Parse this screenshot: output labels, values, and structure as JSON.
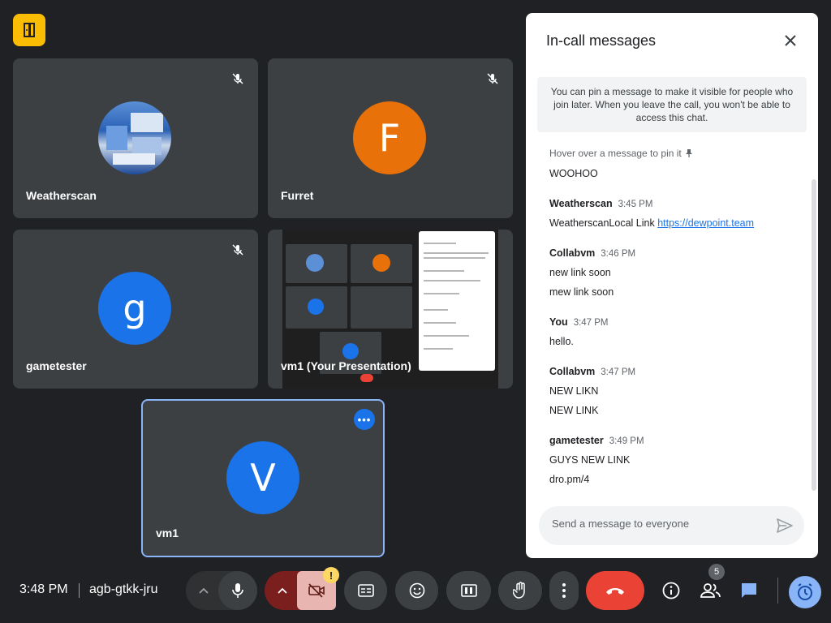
{
  "participants": [
    {
      "name": "Weatherscan",
      "type": "image"
    },
    {
      "name": "Furret",
      "initial": "F",
      "color": "#e8710a"
    },
    {
      "name": "gametester",
      "initial": "g",
      "color": "#1a73e8"
    },
    {
      "name": "vm1 (Your Presentation)",
      "type": "presentation"
    },
    {
      "name": "vm1",
      "initial": "V",
      "color": "#1a73e8"
    }
  ],
  "chat": {
    "title": "In-call messages",
    "pin_info": "You can pin a message to make it visible for people who join later. When you leave the call, you won't be able to access this chat.",
    "hover_hint": "Hover over a message to pin it",
    "first_message": "WOOHOO",
    "messages": [
      {
        "sender": "Weatherscan",
        "time": "3:45 PM",
        "lines": [
          "WeatherscanLocal Link",
          "https://dewpoint.team"
        ]
      },
      {
        "sender": "Collabvm",
        "time": "3:46 PM",
        "lines": [
          "new link soon",
          "mew link soon"
        ]
      },
      {
        "sender": "You",
        "time": "3:47 PM",
        "lines": [
          "hello."
        ]
      },
      {
        "sender": "Collabvm",
        "time": "3:47 PM",
        "lines": [
          "NEW LIKN",
          "NEW LINK"
        ]
      },
      {
        "sender": "gametester",
        "time": "3:49 PM",
        "lines": [
          "GUYS NEW LINK",
          "dro.pm/4"
        ]
      }
    ],
    "input_placeholder": "Send a message to everyone"
  },
  "bottom_bar": {
    "time": "3:48 PM",
    "meeting_code": "agb-gtkk-jru",
    "camera_warning": "!",
    "people_count": "5"
  },
  "colors": {
    "background": "#202124",
    "tile": "#3c4043",
    "accent_blue": "#8ab4f8",
    "leave_red": "#ea4335",
    "logo_yellow": "#fbbc04"
  },
  "icons": [
    "door-icon",
    "mic-off-icon",
    "close-icon",
    "pin-icon",
    "send-icon",
    "chevron-up-icon",
    "mic-icon",
    "camera-off-icon",
    "captions-icon",
    "emoji-icon",
    "present-icon",
    "hand-icon",
    "more-vert-icon",
    "call-end-icon",
    "info-icon",
    "people-icon",
    "chat-icon",
    "activities-icon"
  ]
}
